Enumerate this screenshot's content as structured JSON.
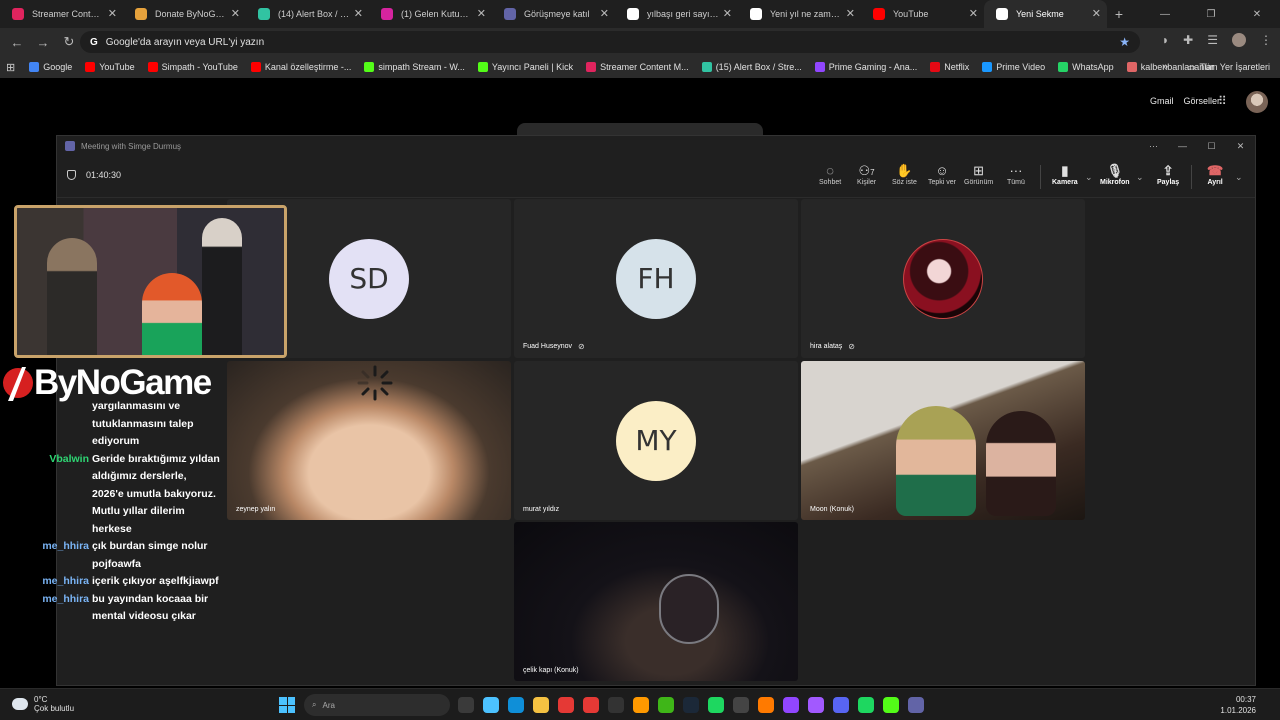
{
  "browser": {
    "tabs": [
      {
        "label": "Streamer Content M...",
        "color": "#e0245e",
        "active": false
      },
      {
        "label": "Donate ByNoGame -",
        "color": "#e6a23c",
        "active": false
      },
      {
        "label": "(14) Alert Box / Strea",
        "color": "#31c3a2",
        "active": false
      },
      {
        "label": "(1) Gelen Kutusu • So",
        "color": "#d6249f",
        "active": false
      },
      {
        "label": "Görüşmeye katıl",
        "color": "#6264a7",
        "active": false
      },
      {
        "label": "yılbaşı geri sayım 20",
        "color": "#ffffff",
        "active": false
      },
      {
        "label": "Yeni yıl ne zaman 20",
        "color": "#ffffff",
        "active": false
      },
      {
        "label": "YouTube",
        "color": "#ff0000",
        "active": false
      },
      {
        "label": "Yeni Sekme",
        "color": "#ffffff",
        "active": true
      }
    ],
    "address_placeholder": "Google'da arayın veya URL'yi yazın",
    "bookmarks": [
      {
        "label": "Google",
        "color": "#4285f4"
      },
      {
        "label": "YouTube",
        "color": "#ff0000"
      },
      {
        "label": "Simpath - YouTube",
        "color": "#ff0000"
      },
      {
        "label": "Kanal özelleştirme -...",
        "color": "#ff0000"
      },
      {
        "label": "simpath Stream - W...",
        "color": "#53fc18"
      },
      {
        "label": "Yayıncı Paneli | Kick",
        "color": "#53fc18"
      },
      {
        "label": "Streamer Content M...",
        "color": "#e0245e"
      },
      {
        "label": "(15) Alert Box / Stre...",
        "color": "#31c3a2"
      },
      {
        "label": "Prime Gaming - Ana...",
        "color": "#9146ff"
      },
      {
        "label": "Netflix",
        "color": "#e50914"
      },
      {
        "label": "Prime Video",
        "color": "#1a98ff"
      },
      {
        "label": "WhatsApp",
        "color": "#25d366"
      },
      {
        "label": "kalbenbanlananlar",
        "color": "#e06666"
      }
    ],
    "all_bookmarks_label": "Tüm Yer İşaretleri"
  },
  "ntp": {
    "gmail": "Gmail",
    "images": "Görseller"
  },
  "meeting": {
    "window_title": "Meeting with Simge Durmuş",
    "timer": "01:40:30",
    "controls": {
      "chat": "Sohbet",
      "people": "Kişiler",
      "people_count": "7",
      "raise": "Söz iste",
      "react": "Tepki ver",
      "view": "Görünüm",
      "more": "Tümü",
      "camera": "Kamera",
      "mic": "Mikrofon",
      "share": "Paylaş",
      "leave": "Ayrıl"
    },
    "participants": {
      "sd": {
        "initials": "SD",
        "color": "#e3e1f5"
      },
      "fh": {
        "initials": "FH",
        "name": "Fuad Huseynov",
        "color": "#d6e2ea"
      },
      "hira": {
        "name": "hira alataş"
      },
      "zeynep": {
        "name": "zeynep yalın"
      },
      "my": {
        "initials": "MY",
        "name": "murat yıldız",
        "color": "#fbeec6"
      },
      "moon": {
        "name": "Moon (Konuk)"
      },
      "celik": {
        "name": "çelik kapı (Konuk)"
      }
    }
  },
  "overlay": {
    "logo_text": "ByNoGame",
    "chat": [
      {
        "user": "",
        "user_color": "#ffffff",
        "text": "yargılanmasını ve"
      },
      {
        "user": "",
        "user_color": "#ffffff",
        "text": "tutuklanmasını talep"
      },
      {
        "user": "",
        "user_color": "#ffffff",
        "text": "ediyorum"
      },
      {
        "user": "Vbalwin",
        "user_color": "#2ed573",
        "text": "Geride bıraktığımız yıldan"
      },
      {
        "user": "",
        "user_color": "#ffffff",
        "text": "aldığımız derslerle,"
      },
      {
        "user": "",
        "user_color": "#ffffff",
        "text": "2026'e umutla bakıyoruz."
      },
      {
        "user": "",
        "user_color": "#ffffff",
        "text": "Mutlu yıllar dilerim"
      },
      {
        "user": "",
        "user_color": "#ffffff",
        "text": "herkese"
      },
      {
        "user": "me_hhira",
        "user_color": "#7ab4f5",
        "text": "çık burdan simge nolur"
      },
      {
        "user": "",
        "user_color": "#ffffff",
        "text": "pojfoawfa"
      },
      {
        "user": "me_hhira",
        "user_color": "#7ab4f5",
        "text": "içerik çıkıyor aşelfkjiawpf"
      },
      {
        "user": "me_hhira",
        "user_color": "#7ab4f5",
        "text": "bu yayından kocaaa bir"
      },
      {
        "user": "",
        "user_color": "#ffffff",
        "text": "mental videosu çıkar"
      }
    ]
  },
  "taskbar": {
    "temperature": "0°C",
    "weather": "Çok bulutlu",
    "search_placeholder": "Ara",
    "time": "00:37",
    "date": "1.01.2026",
    "icon_colors": [
      "#3a3a3a",
      "#4cc2ff",
      "#0f8fd8",
      "#f5c242",
      "#e53935",
      "#e53935",
      "#333333",
      "#ff9900",
      "#3fb618",
      "#1b2838",
      "#1ed760",
      "#444444",
      "#ff7a00",
      "#9146ff",
      "#a259ff",
      "#5865f2",
      "#1ed760",
      "#53fc18",
      "#6264a7"
    ]
  }
}
